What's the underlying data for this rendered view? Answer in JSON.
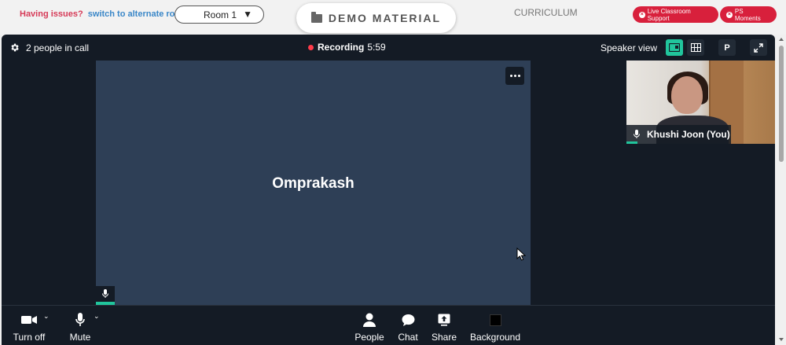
{
  "topbar": {
    "issues_question": "Having issues?",
    "issues_switch": "switch to alternate room",
    "room_value": "Room 1",
    "demo_label": "DEMO MATERIAL",
    "curriculum": "CURRICULUM",
    "live_support": "Live Classroom Support",
    "ps_moments": "PS Moments"
  },
  "callbar": {
    "people_count": "2 people in call",
    "recording_label": "Recording",
    "recording_time": "5:59",
    "speaker_view": "Speaker view",
    "p_label": "P"
  },
  "main": {
    "speaker_name": "Omprakash"
  },
  "self": {
    "name": "Khushi Joon (You)"
  },
  "toolbar": {
    "camera": "Turn off",
    "mute": "Mute",
    "people": "People",
    "chat": "Chat",
    "share": "Share",
    "background": "Background"
  },
  "colors": {
    "accent": "#21c59c",
    "record": "#ff3b4a",
    "support": "#d8203c",
    "tile": "#2e3f56",
    "call_bg": "#141b25"
  }
}
